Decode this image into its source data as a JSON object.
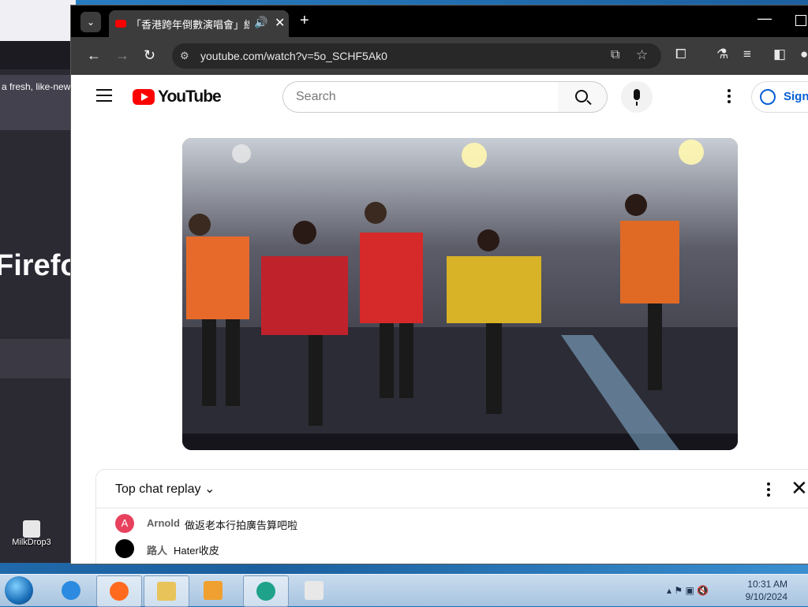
{
  "firefox_bg": {
    "hero_text": "a fresh, like-new",
    "brand_text": "Firefo"
  },
  "desktop": {
    "icon_label": "MilkDrop3"
  },
  "chrome": {
    "tab": {
      "title": "「香港跨年倒數演唱會」線上",
      "close": "✕"
    },
    "new_tab": "+",
    "url": "youtube.com/watch?v=5o_SCHF5Ak0"
  },
  "youtube": {
    "logo_text": "YouTube",
    "search_placeholder": "Search",
    "sign_in": "Sign",
    "chat": {
      "header": "Top chat replay",
      "messages": [
        {
          "avatar_letter": "A",
          "avatar_color": "#e8415e",
          "author": "Arnold",
          "text": "做返老本行拍廣告算吧啦"
        },
        {
          "avatar_letter": "",
          "avatar_color": "#000000",
          "author": "路人",
          "text": "Hater收皮"
        }
      ]
    }
  },
  "taskbar": {
    "time": "10:31 AM",
    "date": "9/10/2024"
  },
  "colors": {
    "youtube_red": "#ff0000",
    "link_blue": "#065fd4"
  }
}
